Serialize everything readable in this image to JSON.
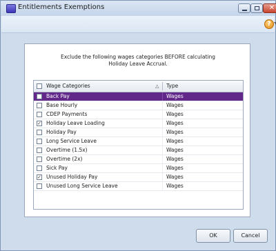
{
  "window": {
    "title": "Entitlements Exemptions"
  },
  "instruction": {
    "line1": "Exclude the following wages categories BEFORE calculating",
    "line2": "Holiday Leave Accrual."
  },
  "grid": {
    "columns": {
      "category": "Wage Categories",
      "type": "Type",
      "sort_indicator": "△"
    },
    "rows": [
      {
        "category": "Back Pay",
        "type": "Wages",
        "checked": false,
        "selected": true
      },
      {
        "category": "Base Hourly",
        "type": "Wages",
        "checked": false,
        "selected": false
      },
      {
        "category": "CDEP Payments",
        "type": "Wages",
        "checked": false,
        "selected": false
      },
      {
        "category": "Holiday Leave Loading",
        "type": "Wages",
        "checked": true,
        "selected": false
      },
      {
        "category": "Holiday Pay",
        "type": "Wages",
        "checked": false,
        "selected": false
      },
      {
        "category": "Long Service Leave",
        "type": "Wages",
        "checked": false,
        "selected": false
      },
      {
        "category": "Overtime (1.5x)",
        "type": "Wages",
        "checked": false,
        "selected": false
      },
      {
        "category": "Overtime (2x)",
        "type": "Wages",
        "checked": false,
        "selected": false
      },
      {
        "category": "Sick Pay",
        "type": "Wages",
        "checked": false,
        "selected": false
      },
      {
        "category": "Unused Holiday Pay",
        "type": "Wages",
        "checked": true,
        "selected": false
      },
      {
        "category": "Unused Long Service Leave",
        "type": "Wages",
        "checked": false,
        "selected": false
      }
    ]
  },
  "buttons": {
    "ok": "OK",
    "cancel": "Cancel"
  },
  "icons": {
    "app": "app-icon",
    "help": "help-icon",
    "minimize": "minimize-icon",
    "maximize": "maximize-icon",
    "close": "close-icon"
  },
  "colors": {
    "selection": "#61288a",
    "frame": "#cfdcec"
  }
}
